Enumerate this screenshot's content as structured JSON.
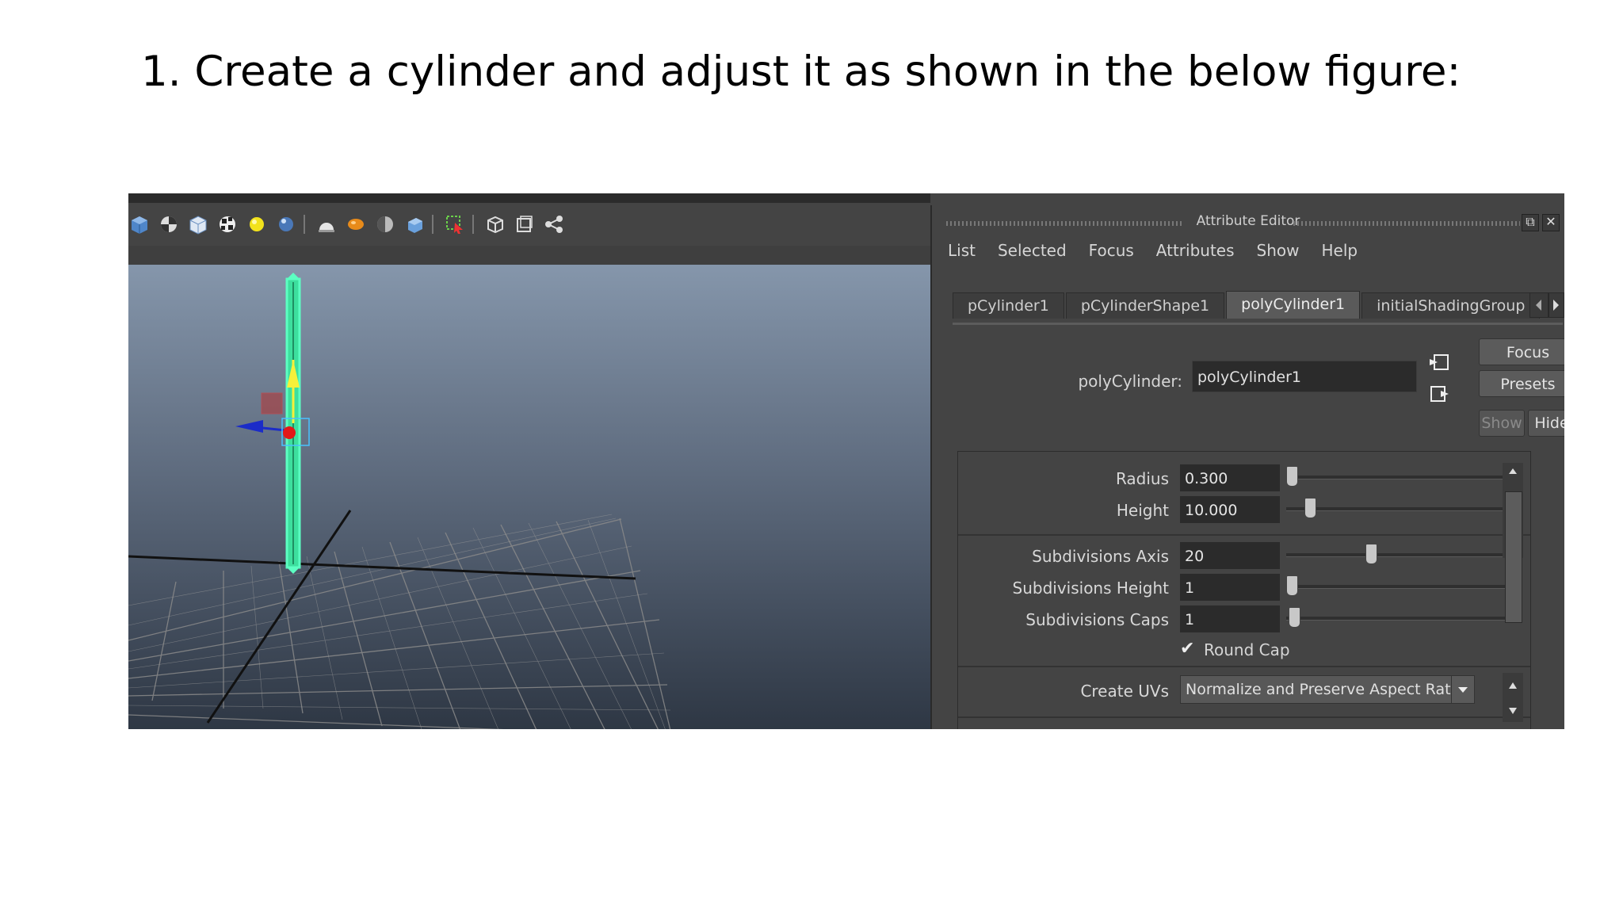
{
  "slide": {
    "title": "1. Create a cylinder and adjust it as shown in the below figure:"
  },
  "viewport": {
    "toolbar_icons": [
      "cube-icon",
      "checker-sphere-icon",
      "wireframe-cube-icon",
      "checker-icon",
      "yellow-light-icon",
      "blue-sphere-icon",
      "separator",
      "spotlight-icon",
      "orange-sphere-icon",
      "half-sphere-icon",
      "blue-cube-icon",
      "separator",
      "select-camera-icon",
      "separator",
      "cube-outline-icon",
      "resolution-gate-icon",
      "share-nodes-icon"
    ],
    "selection_color": "#4ef2b0",
    "grid_color": "#8a8a8a"
  },
  "attribute_editor": {
    "title": "Attribute Editor",
    "menu": [
      "List",
      "Selected",
      "Focus",
      "Attributes",
      "Show",
      "Help"
    ],
    "tabs": [
      "pCylinder1",
      "pCylinderShape1",
      "polyCylinder1",
      "initialShadingGroup"
    ],
    "active_tab": "polyCylinder1",
    "node_label": "polyCylinder:",
    "node_value": "polyCylinder1",
    "buttons": {
      "focus": "Focus",
      "presets": "Presets",
      "show": "Show",
      "hide": "Hide"
    },
    "attributes": [
      {
        "label": "Radius",
        "value": "0.300",
        "slider": 0.02
      },
      {
        "label": "Height",
        "value": "10.000",
        "slider": 0.1
      },
      {
        "label": "Subdivisions Axis",
        "value": "20",
        "slider": 0.37
      },
      {
        "label": "Subdivisions Height",
        "value": "1",
        "slider": 0.02
      },
      {
        "label": "Subdivisions Caps",
        "value": "1",
        "slider": 0.03
      }
    ],
    "round_cap": {
      "label": "Round Cap",
      "checked": true
    },
    "create_uvs": {
      "label": "Create UVs",
      "value": "Normalize and Preserve Aspect Ratio"
    },
    "colors": {
      "panel": "#444444",
      "field": "#2b2b2b",
      "button": "#5b5b5b"
    }
  }
}
